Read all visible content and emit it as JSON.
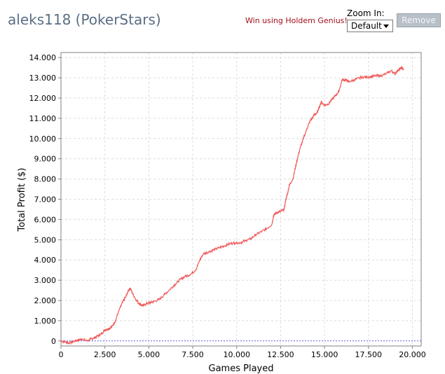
{
  "header": {
    "title": "aleks118 (PokerStars)",
    "promo_link": "Win using Holdem Genius!",
    "zoom_label": "Zoom In:",
    "zoom_value": "Default",
    "remove_label": "Remove"
  },
  "colors": {
    "line": "#f05a5a",
    "zero_line": "#5a5ae6",
    "grid": "#dcdcdc"
  },
  "chart_data": {
    "type": "line",
    "xlabel": "Games Played",
    "ylabel": "Total Profit ($)",
    "xlim": [
      0,
      20500
    ],
    "ylim": [
      -250,
      14250
    ],
    "x_ticks": [
      0,
      2500,
      5000,
      7500,
      10000,
      12500,
      15000,
      17500,
      20000
    ],
    "x_tick_labels": [
      "0",
      "2.500",
      "5.000",
      "7.500",
      "10.000",
      "12.500",
      "15.000",
      "17.500",
      "20.000"
    ],
    "y_ticks": [
      0,
      1000,
      2000,
      3000,
      4000,
      5000,
      6000,
      7000,
      8000,
      9000,
      10000,
      11000,
      12000,
      13000,
      14000
    ],
    "y_tick_labels": [
      "0",
      "1.000",
      "2.000",
      "3.000",
      "4.000",
      "5.000",
      "6.000",
      "7.000",
      "8.000",
      "9.000",
      "10.000",
      "11.000",
      "12.000",
      "13.000",
      "14.000"
    ],
    "grid": true,
    "series": [
      {
        "x": [
          0,
          250,
          500,
          800,
          1000,
          1200,
          1500,
          1700,
          1900,
          2100,
          2300,
          2500,
          2700,
          2900,
          3100,
          3300,
          3500,
          3700,
          3850,
          3950,
          4100,
          4300,
          4500,
          4700,
          4900,
          5100,
          5300,
          5600,
          5900,
          6200,
          6500,
          6800,
          7100,
          7400,
          7700,
          7900,
          8100,
          8400,
          8700,
          9000,
          9300,
          9600,
          9900,
          10200,
          10500,
          10800,
          11100,
          11400,
          11700,
          12000,
          12100,
          12300,
          12500,
          12700,
          12800,
          12900,
          13000,
          13200,
          13400,
          13600,
          13800,
          14000,
          14200,
          14400,
          14600,
          14800,
          15000,
          15200,
          15400,
          15600,
          15800,
          16000,
          16200,
          16400,
          16700,
          17000,
          17300,
          17600,
          17900,
          18200,
          18500,
          18800,
          19000,
          19200,
          19400,
          19500
        ],
        "y": [
          0,
          -50,
          -100,
          0,
          50,
          100,
          0,
          100,
          150,
          250,
          350,
          550,
          600,
          700,
          1000,
          1500,
          1900,
          2200,
          2500,
          2600,
          2300,
          2000,
          1800,
          1750,
          1850,
          1900,
          1950,
          2050,
          2300,
          2550,
          2800,
          3050,
          3200,
          3300,
          3550,
          4000,
          4300,
          4400,
          4500,
          4600,
          4700,
          4800,
          4850,
          4850,
          4950,
          5050,
          5250,
          5400,
          5550,
          5750,
          6200,
          6350,
          6400,
          6500,
          7000,
          7300,
          7700,
          8000,
          8800,
          9500,
          10000,
          10500,
          10900,
          11150,
          11300,
          11800,
          11650,
          11700,
          11900,
          12100,
          12300,
          12900,
          12900,
          12800,
          12900,
          13000,
          13050,
          13050,
          13100,
          13100,
          13200,
          13350,
          13200,
          13400,
          13500,
          13400
        ]
      }
    ]
  }
}
